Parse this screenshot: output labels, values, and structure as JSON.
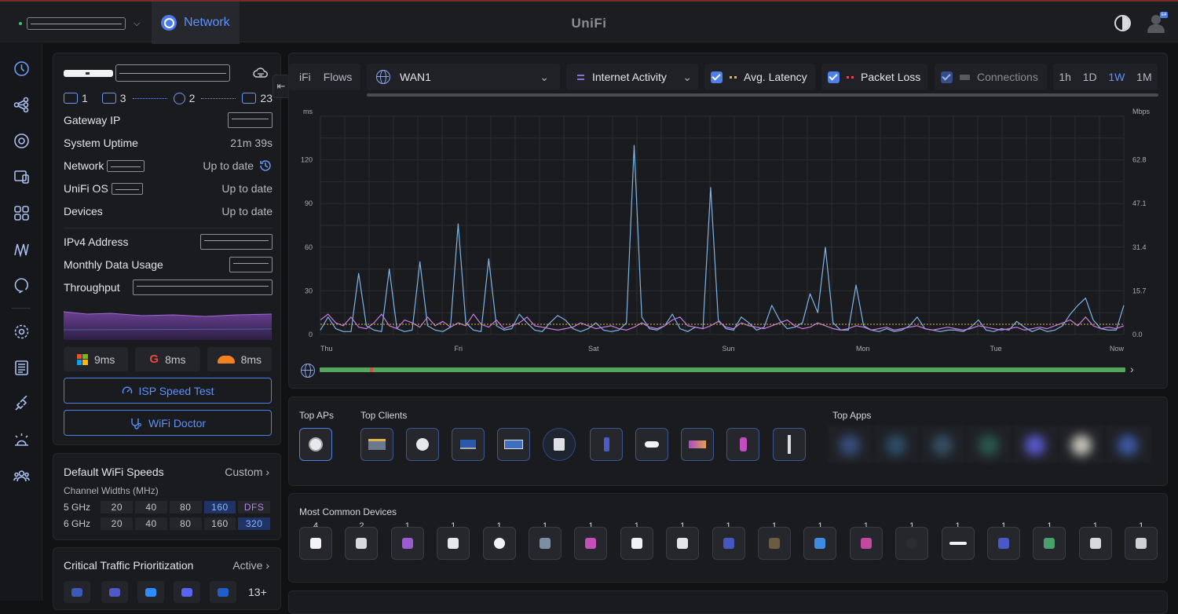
{
  "header": {
    "app_tab": "Network",
    "brand": "UniFi",
    "avatar_badge": "EA"
  },
  "gateway": {
    "counts": [
      "1",
      "3",
      "2",
      "23"
    ],
    "rows": [
      {
        "key": "Gateway IP",
        "value": ""
      },
      {
        "key": "System Uptime",
        "value": "21m 39s"
      },
      {
        "key": "Network",
        "value": "Up to date"
      },
      {
        "key": "UniFi OS",
        "value": "Up to date"
      },
      {
        "key": "Devices",
        "value": "Up to date"
      },
      {
        "key": "IPv4 Address",
        "value": ""
      },
      {
        "key": "Monthly Data Usage",
        "value": ""
      },
      {
        "key": "Throughput",
        "value": ""
      }
    ],
    "latency": [
      {
        "provider": "microsoft-icon",
        "value": "9ms"
      },
      {
        "provider": "google-icon",
        "value": "8ms"
      },
      {
        "provider": "cloudflare-icon",
        "value": "8ms"
      }
    ],
    "speed_test_label": "ISP Speed Test",
    "wifi_doctor_label": "WiFi Doctor"
  },
  "wifi_speeds": {
    "title": "Default WiFi Speeds",
    "mode": "Custom",
    "subtitle": "Channel Widths (MHz)",
    "bands": [
      {
        "label": "5 GHz",
        "widths": [
          "20",
          "40",
          "80",
          "160",
          "DFS"
        ],
        "selected": "160"
      },
      {
        "label": "6 GHz",
        "widths": [
          "20",
          "40",
          "80",
          "160",
          "320"
        ],
        "selected": "320"
      }
    ]
  },
  "traffic_prioritization": {
    "title": "Critical Traffic Prioritization",
    "status": "Active",
    "more": "13+"
  },
  "toolbar": {
    "tab_partial": "iFi",
    "tab_flows": "Flows",
    "wan": "WAN1",
    "activity": "Internet Activity",
    "avg_latency": "Avg. Latency",
    "packet_loss": "Packet Loss",
    "connections": "Connections",
    "ranges": [
      "1h",
      "1D",
      "1W",
      "1M"
    ],
    "active_range": "1W"
  },
  "chart_data": {
    "type": "line",
    "y_left_label": "ms",
    "y_right_label": "Mbps",
    "y_left_ticks": [
      "0",
      "30",
      "60",
      "90",
      "120"
    ],
    "y_right_ticks": [
      "0.0",
      "15.7",
      "31.4",
      "47.1",
      "62.8"
    ],
    "x_labels": [
      "Thu",
      "Fri",
      "Sat",
      "Sun",
      "Mon",
      "Tue",
      "Now"
    ],
    "ylim_left": [
      0,
      150
    ],
    "series": [
      {
        "color": "#7fb4e6",
        "values": [
          3,
          12,
          4,
          2,
          2,
          42,
          6,
          3,
          2,
          45,
          4,
          2,
          3,
          50,
          6,
          3,
          2,
          5,
          76,
          8,
          3,
          2,
          52,
          6,
          3,
          4,
          14,
          8,
          3,
          2,
          8,
          13,
          10,
          4,
          2,
          4,
          8,
          3,
          2,
          3,
          8,
          130,
          12,
          4,
          3,
          6,
          14,
          4,
          2,
          5,
          4,
          101,
          10,
          4,
          3,
          12,
          8,
          3,
          5,
          20,
          10,
          4,
          5,
          8,
          28,
          15,
          60,
          8,
          3,
          3,
          34,
          6,
          3,
          2,
          4,
          2,
          3,
          6,
          12,
          4,
          3,
          2,
          3,
          3,
          2,
          5,
          10,
          3,
          2,
          4,
          3,
          9,
          5,
          2,
          4,
          2,
          3,
          6,
          14,
          20,
          25,
          10,
          4,
          3,
          3,
          20
        ]
      },
      {
        "color": "#c57be0",
        "values": [
          10,
          14,
          8,
          6,
          12,
          5,
          4,
          8,
          14,
          6,
          4,
          10,
          8,
          5,
          12,
          6,
          9,
          5,
          8,
          6,
          14,
          7,
          5,
          10,
          4,
          6,
          8,
          12,
          6,
          5,
          4,
          3,
          4,
          5,
          8,
          6,
          4,
          5,
          6,
          4,
          3,
          5,
          8,
          5,
          4,
          6,
          10,
          12,
          6,
          5,
          4,
          6,
          9,
          5,
          4,
          8,
          6,
          5,
          4,
          6,
          8,
          10,
          6,
          4,
          5,
          8,
          6,
          4,
          3,
          4,
          6,
          5,
          3,
          4,
          5,
          3,
          4,
          5,
          6,
          4,
          3,
          4,
          5,
          4,
          3,
          4,
          6,
          5,
          4,
          3,
          4,
          5,
          3,
          4,
          5,
          4,
          6,
          8,
          10,
          6,
          12,
          6,
          4,
          5,
          4,
          6
        ]
      },
      {
        "color": "#e2b44b",
        "values": [
          7,
          7,
          7,
          7,
          7,
          7,
          7,
          7,
          7,
          7,
          7,
          7,
          7,
          7,
          7,
          7,
          7,
          7,
          7,
          7,
          7,
          7,
          7,
          7,
          7,
          7,
          7,
          7,
          7,
          7,
          7,
          7,
          7,
          7,
          7,
          7,
          7,
          7,
          7,
          7,
          7,
          7,
          7,
          7,
          7,
          7,
          7,
          7,
          7,
          7,
          7,
          7,
          7,
          7,
          7,
          7,
          7,
          7,
          7,
          7,
          7,
          7,
          7,
          7,
          7,
          7,
          7,
          7,
          7,
          7,
          7,
          7,
          7,
          7,
          7,
          7,
          7,
          7,
          7,
          7,
          7,
          7,
          7,
          7,
          7,
          7,
          7,
          7,
          7,
          7,
          7,
          7,
          7,
          7,
          7,
          7,
          7,
          7,
          7,
          7,
          7,
          7,
          7,
          7,
          7,
          7
        ]
      }
    ]
  },
  "tops": {
    "aps_label": "Top APs",
    "clients_label": "Top Clients",
    "apps_label": "Top Apps"
  },
  "common_devices": {
    "title": "Most Common Devices",
    "counts": [
      "4",
      "2",
      "1",
      "1",
      "1",
      "1",
      "1",
      "1",
      "1",
      "1",
      "1",
      "1",
      "1",
      "1",
      "1",
      "1",
      "1",
      "1",
      "1"
    ]
  }
}
